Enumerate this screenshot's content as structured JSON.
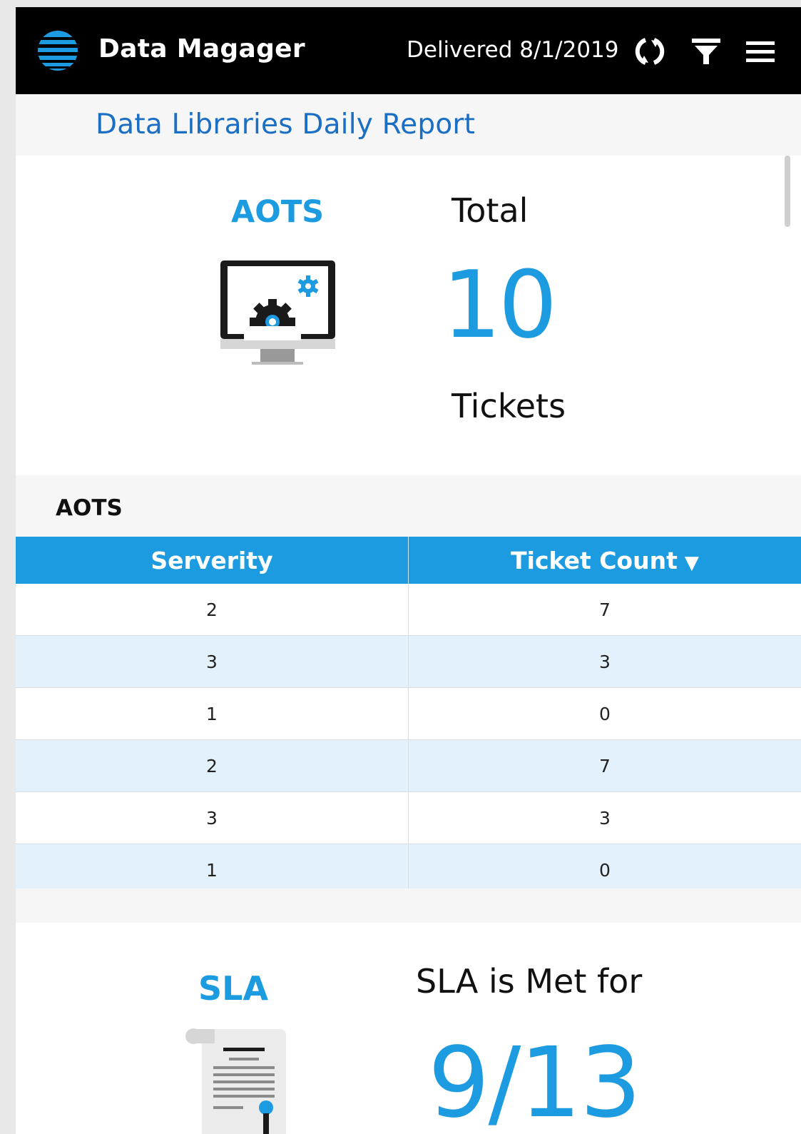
{
  "header": {
    "title": "Data Magager",
    "delivered": "Delivered 8/1/2019",
    "icons": [
      "globe-logo-icon",
      "refresh-icon",
      "filter-icon",
      "menu-icon"
    ]
  },
  "report": {
    "title": "Data Libraries Daily Report"
  },
  "summary": {
    "label": "AOTS",
    "total_label": "Total",
    "total_value": "10",
    "unit_label": "Tickets"
  },
  "table": {
    "caption": "AOTS",
    "columns": [
      "Serverity",
      "Ticket Count"
    ],
    "sort_indicator": "▼",
    "rows": [
      [
        "2",
        "7"
      ],
      [
        "3",
        "3"
      ],
      [
        "1",
        "0"
      ],
      [
        "2",
        "7"
      ],
      [
        "3",
        "3"
      ],
      [
        "1",
        "0"
      ]
    ]
  },
  "sla": {
    "label": "SLA",
    "met_label": "SLA is Met for",
    "value": "9/13"
  },
  "colors": {
    "accent": "#1d9be1",
    "link": "#1a6fc4",
    "header_bg": "#000000",
    "row_alt": "#e2f1fb"
  }
}
